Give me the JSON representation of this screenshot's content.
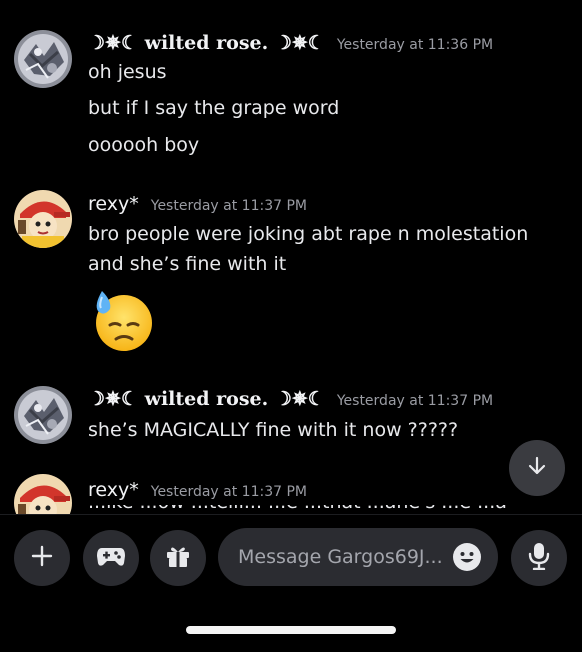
{
  "messages": [
    {
      "author": "☽✵☾ wilted rose. ☽✵☾",
      "timestamp": "Yesterday at 11:36 PM",
      "lines": [
        "oh jesus",
        "but if I say the grape word",
        "oooooh boy"
      ]
    },
    {
      "author": "rexy*",
      "timestamp": "Yesterday at 11:37 PM",
      "lines": [
        "bro people were joking abt rape n molestation",
        "and she’s fine with it"
      ],
      "emoji": "downcast-face-with-sweat"
    },
    {
      "author": "☽✵☾ wilted rose. ☽✵☾",
      "timestamp": "Yesterday at 11:37 PM",
      "lines": [
        "she’s MAGICALLY fine with it now ?????"
      ]
    },
    {
      "author": "rexy*",
      "timestamp": "Yesterday at 11:37 PM",
      "lines": [
        "...ike ...ow ...telli... ...e ...that ...ahe's ...e ...at ...e"
      ]
    }
  ],
  "composer": {
    "placeholder": "Message Gargos69J..."
  },
  "icons": {
    "add": "plus-icon",
    "apps": "gamepad-icon",
    "gift": "gift-icon",
    "emoji": "smiley-icon",
    "voice": "microphone-icon",
    "jump": "arrow-down-icon"
  },
  "colors": {
    "background": "#000000",
    "surface": "#2b2c31",
    "timestamp": "#9a9ca3",
    "text": "#e8e9ec"
  }
}
